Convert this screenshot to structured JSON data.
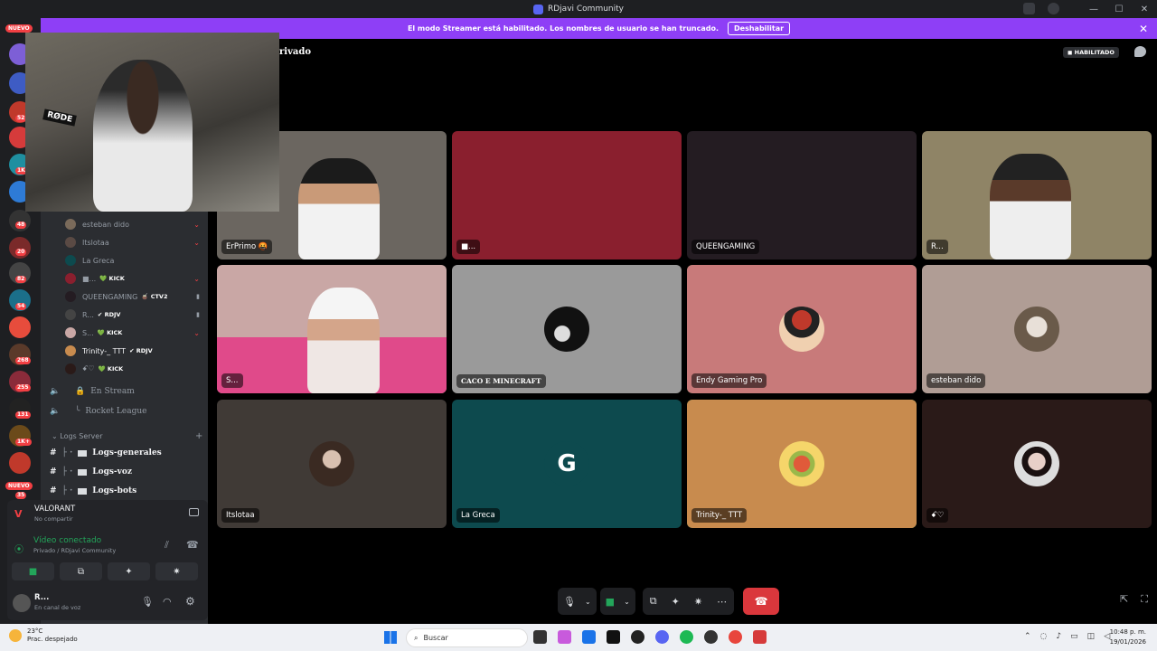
{
  "window": {
    "title": "RDjavi Community",
    "controls": [
      "—",
      "☐",
      "✕"
    ]
  },
  "banner": {
    "message": "El modo Streamer está habilitado. Los nombres de usuario se han truncado.",
    "disable_label": "Deshabilitar",
    "close": "✕"
  },
  "servers": {
    "badges": [
      "52",
      "1K",
      "48",
      "20",
      "82",
      "54",
      "268",
      "255",
      "131",
      "1K+",
      "35"
    ],
    "new_label_top": "NUEVO",
    "new_label_bottom": "NUEVO"
  },
  "stage": {
    "title_fragment": "rivado",
    "streamer_badge": "HABILITADO"
  },
  "members": [
    {
      "name": "esteban dido",
      "tag": ""
    },
    {
      "name": "Itslotaa",
      "tag": ""
    },
    {
      "name": "La Greca",
      "tag": ""
    },
    {
      "name": "■...",
      "tag": "💚 KICK"
    },
    {
      "name": "QUEENGAMING",
      "tag": "🧉 CTV2"
    },
    {
      "name": "R...",
      "tag": "✔ RDJV"
    },
    {
      "name": "S...",
      "tag": "💚 KICK"
    },
    {
      "name": "Trinity-_ TTT",
      "tag": "✔ RDJV"
    },
    {
      "name": "ꗃ♡",
      "tag": "💚 KICK"
    }
  ],
  "voice_channels": [
    {
      "name": "En Stream",
      "prefix": "🔒"
    },
    {
      "name": "Rocket League",
      "prefix": "╰"
    }
  ],
  "category": "Logs Server",
  "text_channels": [
    "Logs-generales",
    "Logs-voz",
    "Logs-bots"
  ],
  "activity": {
    "game": "VALORANT",
    "sub": "No compartir"
  },
  "voice_status": {
    "status": "Vídeo conectado",
    "location": "Privado / RDjavi Community"
  },
  "user": {
    "name": "R...",
    "status": "En canal de voz"
  },
  "webcam_overlay": {
    "mic_brand": "RØDE"
  },
  "tiles": [
    {
      "label": "ErPrimo 🤬",
      "bg": "#6b6660"
    },
    {
      "label": "■...",
      "bg": "#8a1f2e"
    },
    {
      "label": "QUEENGAMING",
      "bg": "#241c22"
    },
    {
      "label": "R...",
      "bg": "#8f8466"
    },
    {
      "label": "S...",
      "bg": "#c9a7a5"
    },
    {
      "label": "CACO E MINECRAFT",
      "bg": "#9a9a9a"
    },
    {
      "label": "Endy Gaming Pro",
      "bg": "#c87a7a"
    },
    {
      "label": "esteban dido",
      "bg": "#b09d95"
    },
    {
      "label": "Itslotaa",
      "bg": "#403a36"
    },
    {
      "label": "La Greca",
      "bg": "#0d4a4e"
    },
    {
      "label": "Trinity-_ TTT",
      "bg": "#c88b4e"
    },
    {
      "label": "ꗃ♡",
      "bg": "#2a1a18"
    }
  ],
  "taskbar": {
    "temp": "23°C",
    "weather": "Prac. despejado",
    "search_placeholder": "Buscar",
    "time": "10:48 p. m.",
    "date": "19/01/2026"
  },
  "colors": {
    "accent": "#8e3ff6",
    "speaking": "#3ba55d",
    "danger": "#da373c",
    "connected": "#23a55a"
  }
}
